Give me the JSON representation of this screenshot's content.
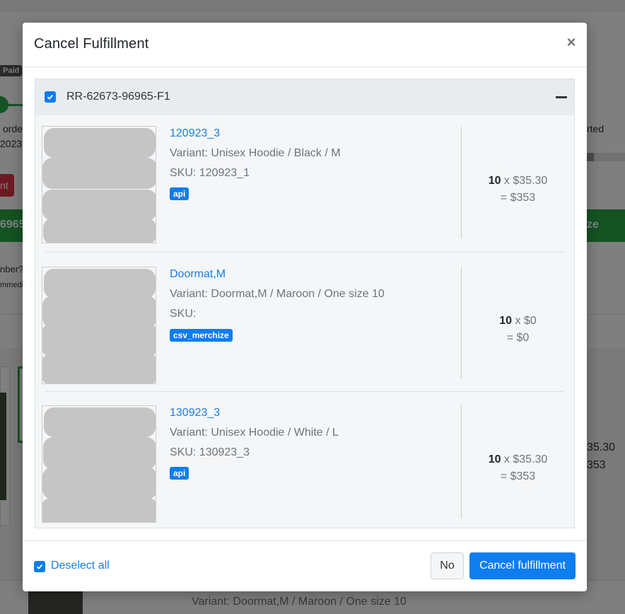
{
  "background": {
    "paid_badge": "Paid",
    "order_label": "orde",
    "order_year": "2023",
    "started_label": "rted",
    "red_button_label": "nt",
    "green_bar_left": "6965",
    "green_bar_right": "ze",
    "tracking_label": "nber?",
    "tracking_sub": "mmedi",
    "price_a": "35.30",
    "price_b": "353",
    "variant_row": "Variant: Doormat,M / Maroon / One size 10"
  },
  "modal": {
    "title": "Cancel Fulfillment",
    "close_label": "×",
    "group": {
      "code": "RR-62673-96965-F1",
      "checked": true,
      "items": [
        {
          "name": "120923_3",
          "variant": "Variant: Unisex Hoodie / Black / M",
          "sku": "SKU:  120923_1",
          "badge": "api",
          "qty": "10",
          "unit": " x $35.30",
          "total": "= $353"
        },
        {
          "name": "Doormat,M",
          "variant": "Variant: Doormat,M / Maroon / One size 10",
          "sku": "SKU:",
          "badge": "csv_merchize",
          "qty": "10",
          "unit": " x $0",
          "total": "= $0"
        },
        {
          "name": "130923_3",
          "variant": "Variant: Unisex Hoodie / White / L",
          "sku": "SKU:  130923_3",
          "badge": "api",
          "qty": "10",
          "unit": " x $35.30",
          "total": "= $353"
        }
      ]
    },
    "footer": {
      "deselect_label": "Deselect all",
      "no_label": "No",
      "cancel_label": "Cancel fulfillment"
    }
  },
  "colors": {
    "primary": "#0d7df0",
    "success": "#28a745",
    "danger": "#dc3545"
  }
}
